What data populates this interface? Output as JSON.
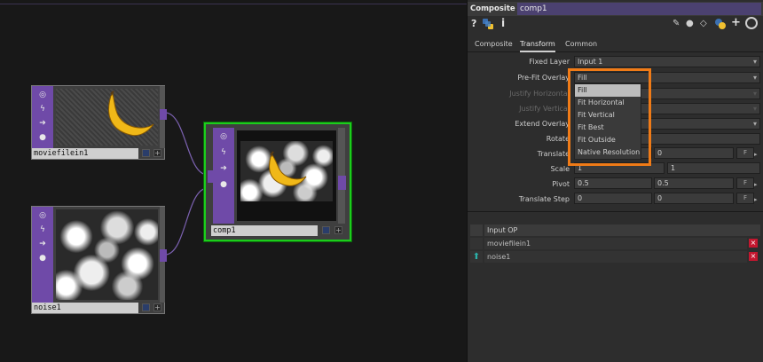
{
  "network": {
    "nodes": [
      {
        "id": "moviefilein1",
        "label": "moviefilein1"
      },
      {
        "id": "noise1",
        "label": "noise1"
      },
      {
        "id": "comp1",
        "label": "comp1"
      }
    ]
  },
  "panel": {
    "op_type": "Composite",
    "op_name": "comp1",
    "tabs": [
      "Composite",
      "Transform",
      "Common"
    ],
    "params": {
      "fixed_layer": {
        "label": "Fixed Layer",
        "value": "Input 1"
      },
      "prefit_overlay": {
        "label": "Pre-Fit Overlay",
        "value": "Fill"
      },
      "justify_horizontal": {
        "label": "Justify Horizontal"
      },
      "justify_vertical": {
        "label": "Justify Vertical"
      },
      "extend_overlay": {
        "label": "Extend Overlay"
      },
      "rotate": {
        "label": "Rotate"
      },
      "translate": {
        "label": "Translate",
        "v2": "0",
        "f": "F"
      },
      "scale": {
        "label": "Scale",
        "v1": "1",
        "v2": "1"
      },
      "pivot": {
        "label": "Pivot",
        "v1": "0.5",
        "v2": "0.5",
        "f": "F"
      },
      "translate_step": {
        "label": "Translate Step",
        "v1": "0",
        "v2": "0",
        "f": "F"
      }
    },
    "dropdown_options": [
      "Fill",
      "Fit Horizontal",
      "Fit Vertical",
      "Fit Best",
      "Fit Outside",
      "Native Resolution"
    ],
    "inputs_table": {
      "header": "Input OP",
      "rows": [
        "moviefilein1",
        "noise1"
      ],
      "remove": "×"
    }
  },
  "icons": {
    "help": "?",
    "python": "python-icon",
    "info": "i"
  }
}
